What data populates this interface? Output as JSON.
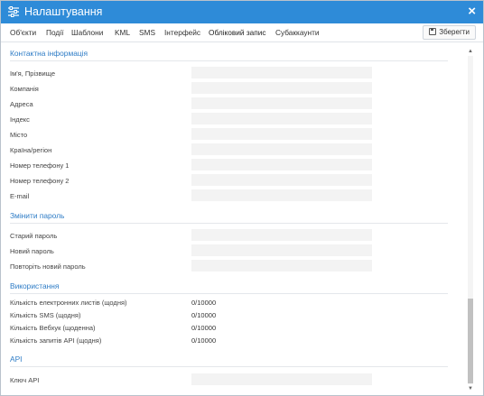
{
  "window": {
    "title": "Налаштування",
    "close_label": "×"
  },
  "tabs": [
    {
      "label": "Об'єкти"
    },
    {
      "label": "Події"
    },
    {
      "label": "Шаблони"
    },
    {
      "label": "KML"
    },
    {
      "label": "SMS"
    },
    {
      "label": "Інтерфейс"
    },
    {
      "label": "Обліковий запис",
      "active": true
    },
    {
      "label": "Субаккаунти"
    }
  ],
  "toolbar": {
    "save_label": "Зберегти"
  },
  "contact": {
    "title": "Контактна інформація",
    "fields": [
      {
        "label": "Ім'я, Прізвище",
        "value": ""
      },
      {
        "label": "Компанія",
        "value": ""
      },
      {
        "label": "Адреса",
        "value": ""
      },
      {
        "label": "Індекс",
        "value": ""
      },
      {
        "label": "Місто",
        "value": ""
      },
      {
        "label": "Країна/регіон",
        "value": ""
      },
      {
        "label": "Номер телефону 1",
        "value": ""
      },
      {
        "label": "Номер телефону 2",
        "value": ""
      },
      {
        "label": "E-mail",
        "value": ""
      }
    ]
  },
  "password": {
    "title": "Змінити пароль",
    "fields": [
      {
        "label": "Старий пароль",
        "value": ""
      },
      {
        "label": "Новий пароль",
        "value": ""
      },
      {
        "label": "Повторіть новий пароль",
        "value": ""
      }
    ]
  },
  "usage": {
    "title": "Використання",
    "rows": [
      {
        "label": "Кількість електронних листів (щодня)",
        "value": "0/10000"
      },
      {
        "label": "Кількість SMS (щодня)",
        "value": "0/10000"
      },
      {
        "label": "Кількість Вебхук (щоденна)",
        "value": "0/10000"
      },
      {
        "label": "Кількість запитів API (щодня)",
        "value": "0/10000"
      }
    ]
  },
  "api": {
    "title": "API",
    "fields": [
      {
        "label": "Ключ API",
        "value": ""
      }
    ]
  },
  "colors": {
    "titlebar": "#2e8bd8",
    "section_title": "#2e7cc6",
    "input_bg": "#f3f3f3"
  },
  "icons": {
    "title": "sliders-icon",
    "save": "floppy-disk-icon",
    "close": "close-icon"
  }
}
